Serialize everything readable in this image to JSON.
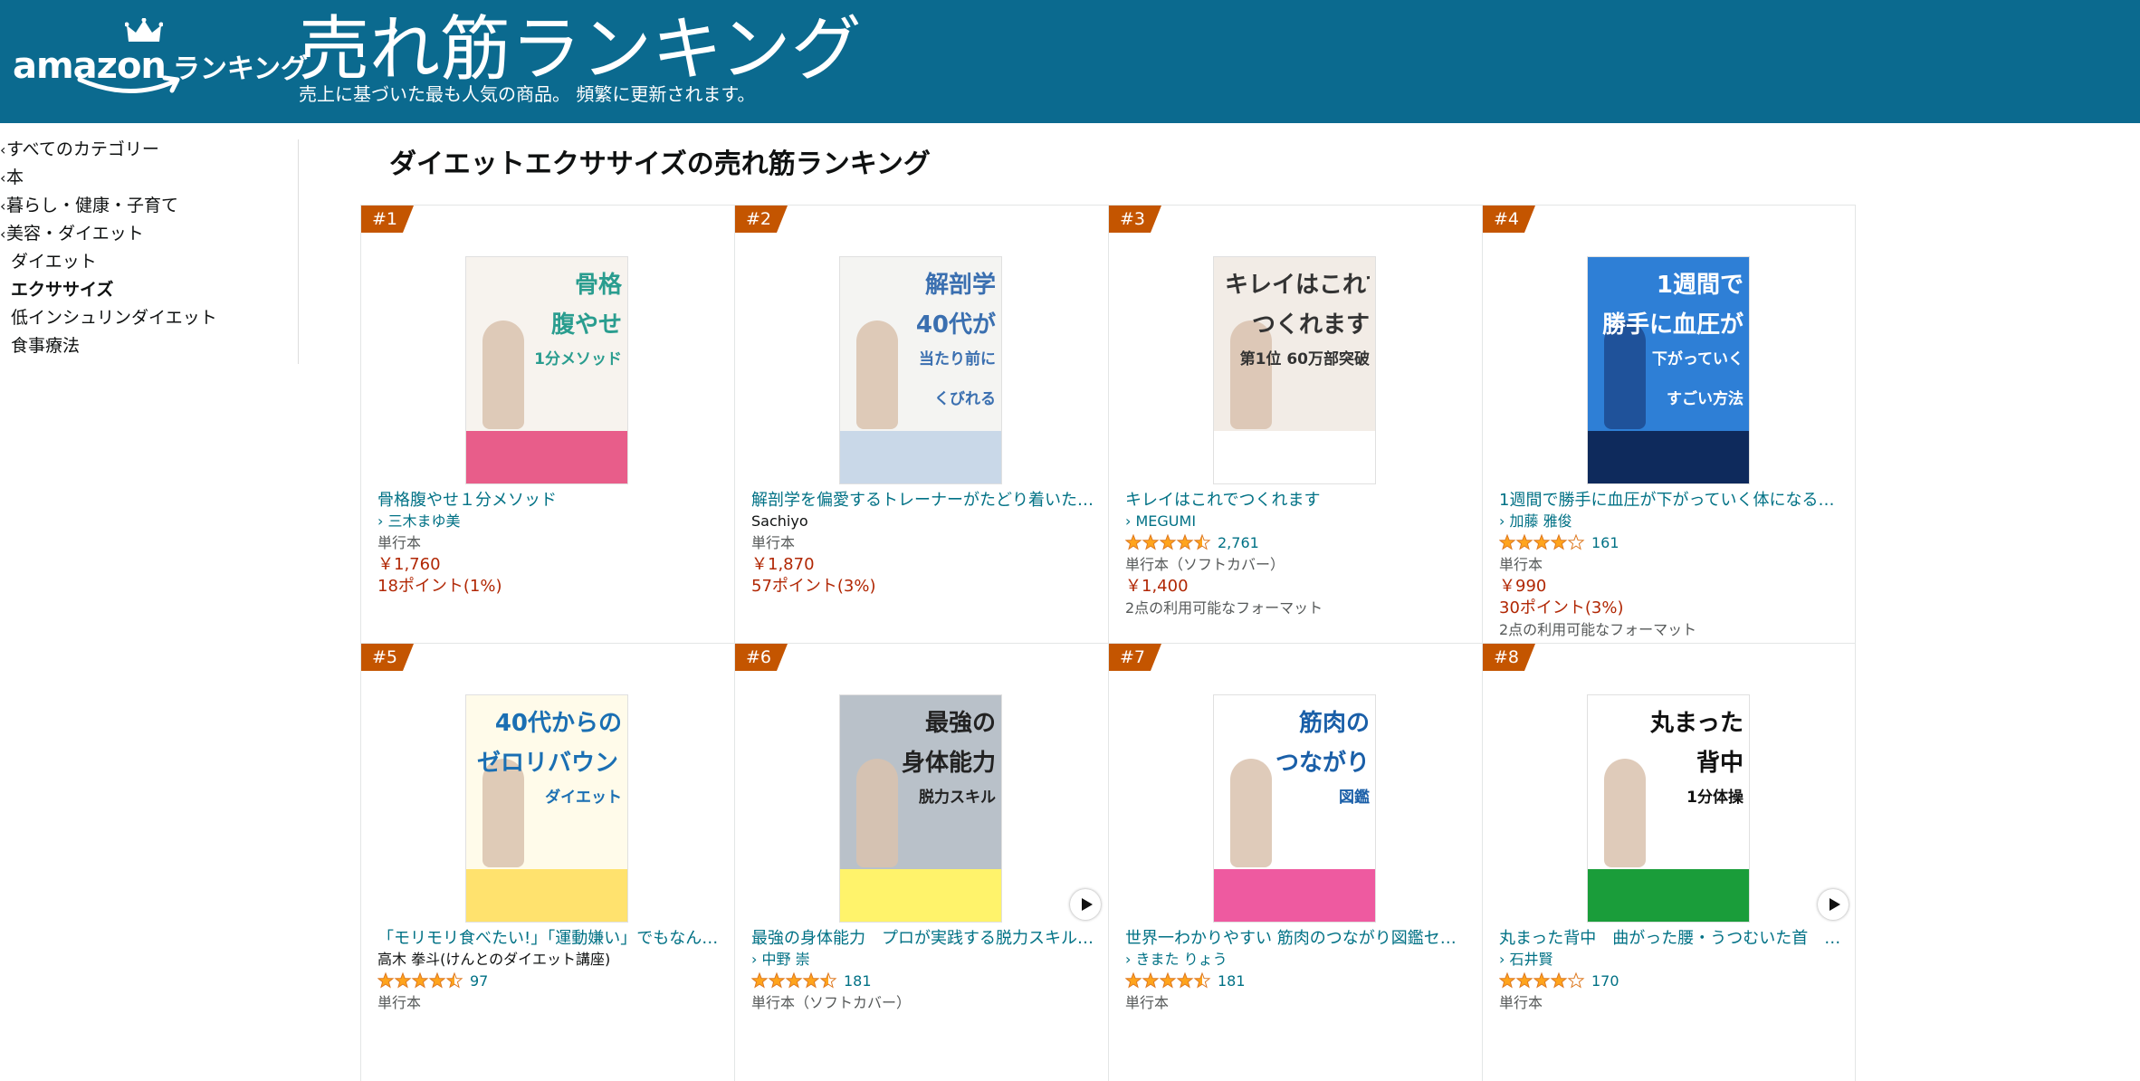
{
  "header": {
    "logo_amazon": "amazon",
    "logo_ranking": "ランキング",
    "title": "売れ筋ランキング",
    "subtitle": "売上に基づいた最も人気の商品。 頻繁に更新されます。"
  },
  "sidebar": {
    "categories": [
      {
        "label": "すべてのカテゴリー",
        "chevron": "‹"
      },
      {
        "label": "本",
        "chevron": "‹"
      },
      {
        "label": "暮らし・健康・子育て",
        "chevron": "‹"
      },
      {
        "label": "美容・ダイエット",
        "chevron": "‹"
      },
      {
        "label": "ダイエット"
      },
      {
        "label": "エクササイズ"
      },
      {
        "label": "低インシュリンダイエット"
      },
      {
        "label": "食事療法"
      }
    ]
  },
  "page_title": "ダイエットエクササイズの売れ筋ランキング",
  "colors": {
    "header": "#0b6a8f",
    "badge": "#c45500",
    "link": "#007185",
    "price": "#b12704",
    "star": "#ffa41c"
  },
  "products": [
    {
      "rank": "#1",
      "title": "骨格腹やせ１分メソッド",
      "author": "三木まゆ美",
      "author_link": true,
      "rating": null,
      "reviews": "",
      "format": "単行本",
      "price": "￥1,760",
      "points": "18ポイント(1%)",
      "formats": ""
    },
    {
      "rank": "#2",
      "title": "解剖学を偏愛するトレーナーがたどり着いた!…",
      "author": "Sachiyo",
      "author_link": false,
      "rating": null,
      "reviews": "",
      "format": "単行本",
      "price": "￥1,870",
      "points": "57ポイント(3%)",
      "formats": ""
    },
    {
      "rank": "#3",
      "title": "キレイはこれでつくれます",
      "author": "MEGUMI",
      "author_link": true,
      "rating": 4.5,
      "reviews": "2,761",
      "format": "単行本（ソフトカバー）",
      "price": "￥1,400",
      "points": "",
      "formats": "2点の利用可能なフォーマット"
    },
    {
      "rank": "#4",
      "title": "1週間で勝手に血圧が下がっていく体になる…",
      "author": "加藤 雅俊",
      "author_link": true,
      "rating": 4.0,
      "reviews": "161",
      "format": "単行本",
      "price": "￥990",
      "points": "30ポイント(3%)",
      "formats": "2点の利用可能なフォーマット"
    },
    {
      "rank": "#5",
      "title": "「モリモリ食べたい!」「運動嫌い」でもなん…",
      "author": "高木 拳斗(けんとのダイエット講座)",
      "author_link": false,
      "rating": 4.5,
      "reviews": "97",
      "format": "単行本",
      "price": "",
      "points": "",
      "formats": ""
    },
    {
      "rank": "#6",
      "title": "最強の身体能力　プロが実践する脱力スキル…",
      "author": "中野 崇",
      "author_link": true,
      "rating": 4.5,
      "reviews": "181",
      "format": "単行本（ソフトカバー）",
      "price": "",
      "points": "",
      "formats": ""
    },
    {
      "rank": "#7",
      "title": "世界一わかりやすい 筋肉のつながり図鑑セル…",
      "author": "きまた りょう",
      "author_link": true,
      "rating": 4.5,
      "reviews": "181",
      "format": "単行本",
      "price": "",
      "points": "",
      "formats": ""
    },
    {
      "rank": "#8",
      "title": "丸まった背中　曲がった腰・うつむいた首　…",
      "author": "石井賢",
      "author_link": true,
      "rating": 4.0,
      "reviews": "170",
      "format": "単行本",
      "price": "",
      "points": "",
      "formats": ""
    }
  ],
  "covers": [
    {
      "lines": [
        "骨格",
        "腹やせ",
        "1分メソッド"
      ],
      "accent": "#2a9d8f",
      "bg": "#f7f3ee",
      "band": "#e85d8a"
    },
    {
      "lines": [
        "解剖学",
        "40代が",
        "当たり前に",
        "くびれる"
      ],
      "accent": "#3a6fb0",
      "bg": "#f4f4f2",
      "band": "#c9d8e8"
    },
    {
      "lines": [
        "キレイはこれで",
        "つくれます",
        "第1位 60万部突破"
      ],
      "accent": "#333333",
      "bg": "#f2ece6",
      "band": "#ffffff"
    },
    {
      "lines": [
        "1週間で",
        "勝手に血圧が",
        "下がっていく",
        "すごい方法"
      ],
      "accent": "#ffffff",
      "bg": "#2e7fd6",
      "band": "#0e2a5c"
    },
    {
      "lines": [
        "40代からの",
        "ゼロリバウンド",
        "ダイエット"
      ],
      "accent": "#1a6fb3",
      "bg": "#fffbea",
      "band": "#ffe26e"
    },
    {
      "lines": [
        "最強の",
        "身体能力",
        "脱力スキル"
      ],
      "accent": "#222222",
      "bg": "#b9c1c9",
      "band": "#fff36b"
    },
    {
      "lines": [
        "筋肉の",
        "つながり",
        "図鑑"
      ],
      "accent": "#1a5fa8",
      "bg": "#ffffff",
      "band": "#ee5aa0"
    },
    {
      "lines": [
        "丸まった",
        "背中",
        "1分体操"
      ],
      "accent": "#111111",
      "bg": "#ffffff",
      "band": "#1a9d3a"
    }
  ]
}
